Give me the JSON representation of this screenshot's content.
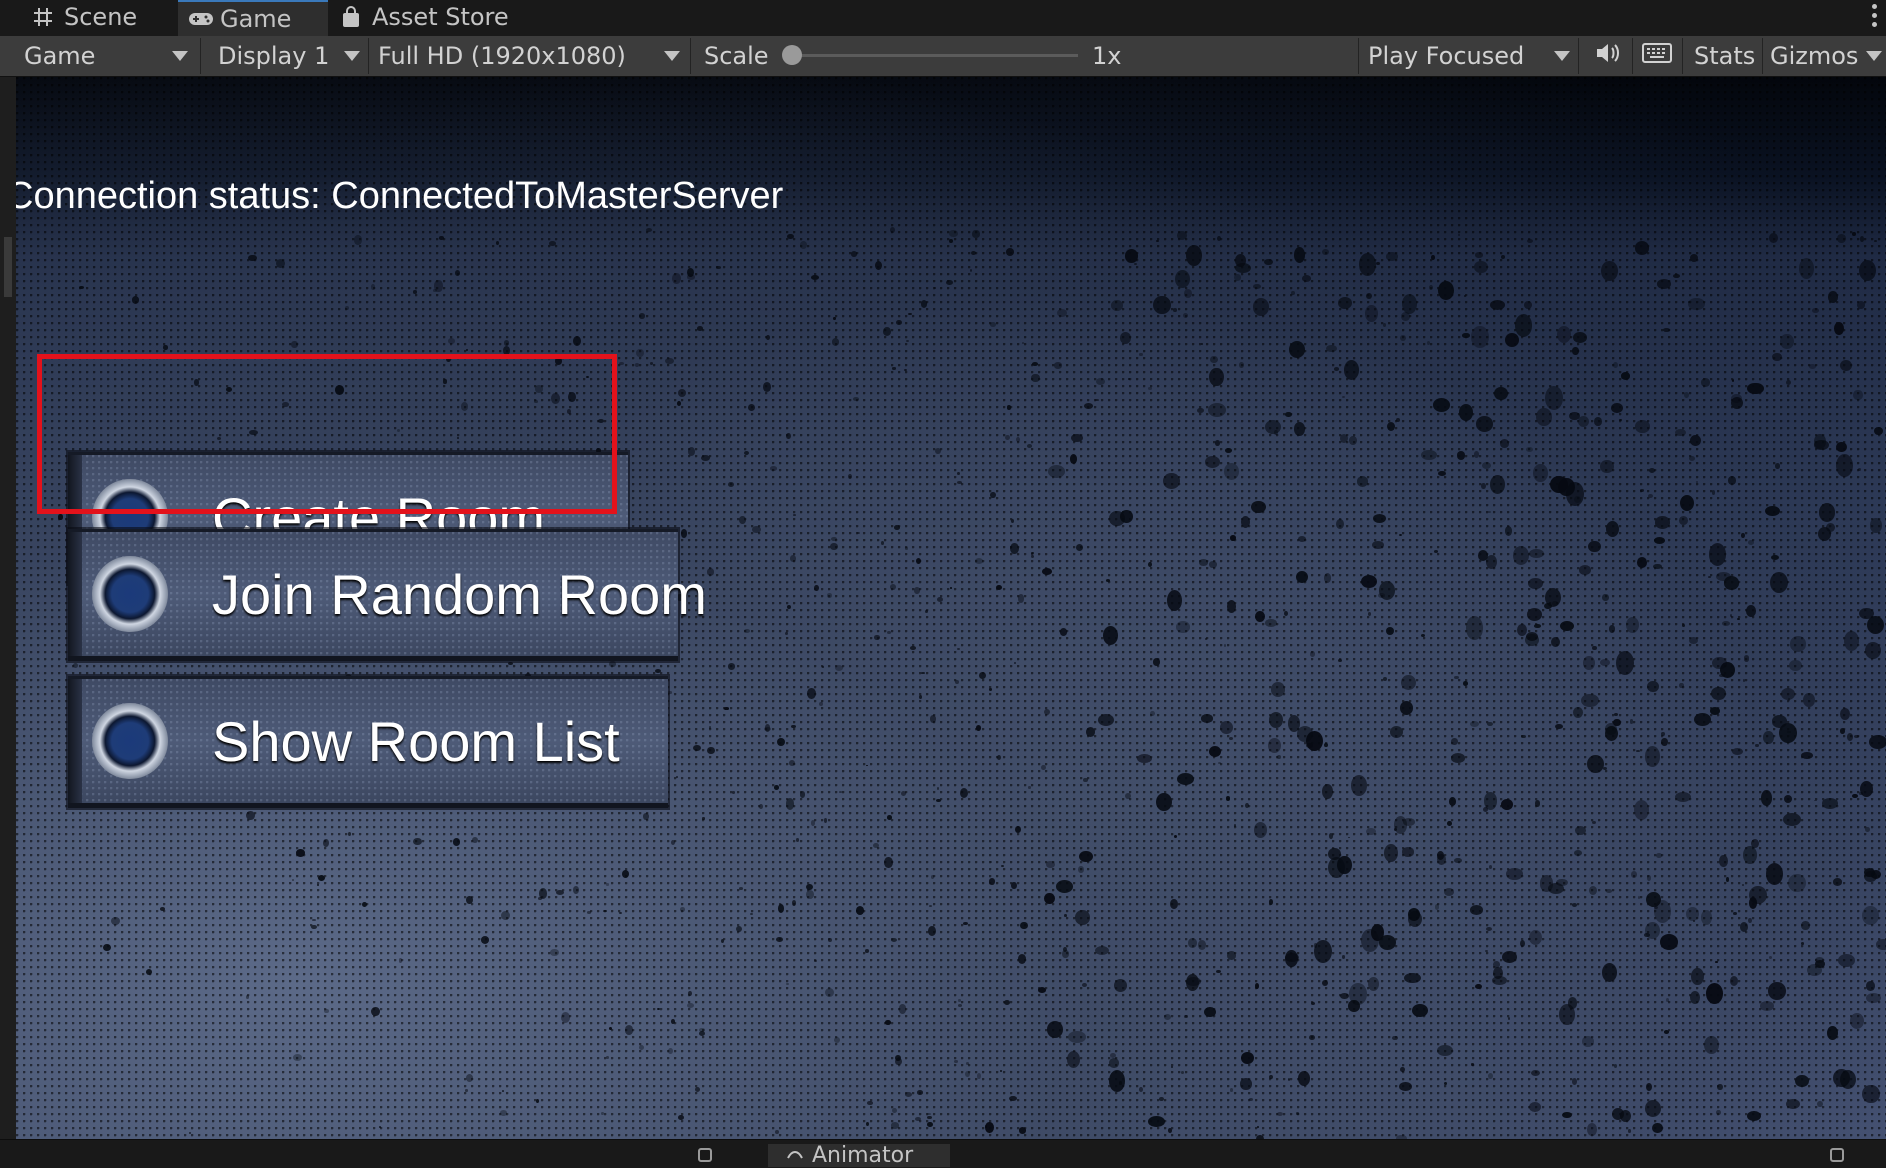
{
  "tabs": {
    "scene": "Scene",
    "game": "Game",
    "asset_store": "Asset Store"
  },
  "toolbar": {
    "view_mode": "Game",
    "display": "Display 1",
    "resolution": "Full HD (1920x1080)",
    "scale_label": "Scale",
    "scale_value": "1x",
    "play_mode": "Play Focused",
    "stats": "Stats",
    "gizmos": "Gizmos"
  },
  "game": {
    "status_text": "Connection status: ConnectedToMasterServer",
    "buttons": [
      "Create Room",
      "Join Random Room",
      "Show Room List"
    ],
    "highlight_color": "#e3121b"
  },
  "bottom": {
    "animator_tab": "Animator"
  },
  "icons": {
    "scene": "grid-icon",
    "game": "gamepad-icon",
    "asset_store": "shopping-bag-icon",
    "audio": "speaker-icon",
    "stats_toggle": "keyboard-icon",
    "animator": "animator-icon"
  }
}
